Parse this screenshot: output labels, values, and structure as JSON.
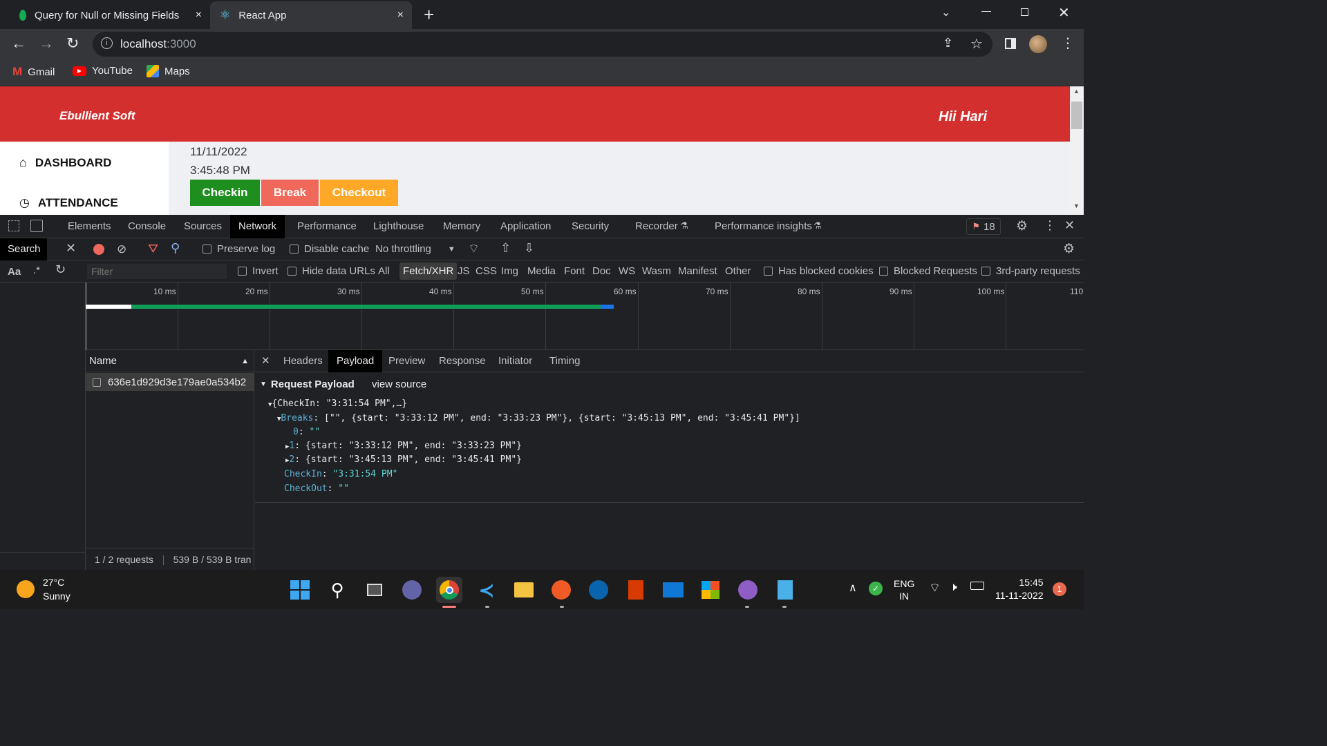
{
  "browser": {
    "tabs": [
      {
        "title": "Query for Null or Missing Fields",
        "close": "×"
      },
      {
        "title": "React App",
        "close": "×"
      }
    ],
    "new_tab": "+",
    "address": {
      "host": "localhost",
      "port": ":3000"
    },
    "bookmarks": [
      {
        "label": "Gmail"
      },
      {
        "label": "YouTube"
      },
      {
        "label": "Maps"
      }
    ]
  },
  "page": {
    "brand": "Ebullient Soft",
    "greeting": "Hii Hari",
    "sidebar": [
      {
        "label": "DASHBOARD"
      },
      {
        "label": "ATTENDANCE"
      }
    ],
    "date": "11/11/2022",
    "time": "3:45:48 PM",
    "buttons": {
      "checkin": "Checkin",
      "break": "Break",
      "checkout": "Checkout"
    },
    "colors": {
      "header": "#d32f2f",
      "checkin": "#1e8e1e",
      "break": "#f0685a",
      "checkout": "#ffa726"
    }
  },
  "devtools": {
    "tabs": [
      "Elements",
      "Console",
      "Sources",
      "Network",
      "Performance",
      "Lighthouse",
      "Memory",
      "Application",
      "Security",
      "Recorder",
      "Performance insights"
    ],
    "active_tab": "Network",
    "issues_count": "18",
    "toolbar": {
      "search": "Search",
      "preserve_log": "Preserve log",
      "disable_cache": "Disable cache",
      "throttling": "No throttling"
    },
    "filter": {
      "placeholder": "Filter",
      "invert": "Invert",
      "hide_data_urls": "Hide data URLs",
      "types": [
        "All",
        "Fetch/XHR",
        "JS",
        "CSS",
        "Img",
        "Media",
        "Font",
        "Doc",
        "WS",
        "Wasm",
        "Manifest",
        "Other"
      ],
      "active_type": "Fetch/XHR",
      "has_blocked_cookies": "Has blocked cookies",
      "blocked_requests": "Blocked Requests",
      "third_party": "3rd-party requests",
      "aa": "Aa",
      "regex": ".*"
    },
    "timeline_ticks": [
      "10 ms",
      "20 ms",
      "30 ms",
      "40 ms",
      "50 ms",
      "60 ms",
      "70 ms",
      "80 ms",
      "90 ms",
      "100 ms",
      "110"
    ],
    "request_list": {
      "header": "Name",
      "rows": [
        "636e1d929d3e179ae0a534b2"
      ],
      "footer_requests": "1 / 2 requests",
      "footer_size": "539 B / 539 B tran"
    },
    "detail_tabs": [
      "Headers",
      "Payload",
      "Preview",
      "Response",
      "Initiator",
      "Timing"
    ],
    "active_detail_tab": "Payload",
    "payload": {
      "section": "Request Payload",
      "view_source": "view source",
      "summary": "{CheckIn: \"3:31:54 PM\",…}",
      "breaks_key": "Breaks",
      "breaks_summary": "[\"\", {start: \"3:33:12 PM\", end: \"3:33:23 PM\"}, {start: \"3:45:13 PM\", end: \"3:45:41 PM\"}]",
      "break_items": [
        {
          "key": "0",
          "value": "\"\""
        },
        {
          "key": "1",
          "value": "{start: \"3:33:12 PM\", end: \"3:33:23 PM\"}"
        },
        {
          "key": "2",
          "value": "{start: \"3:45:13 PM\", end: \"3:45:41 PM\"}"
        }
      ],
      "checkin_key": "CheckIn",
      "checkin_value": "\"3:31:54 PM\"",
      "checkout_key": "CheckOut",
      "checkout_value": "\"\""
    }
  },
  "taskbar": {
    "weather_temp": "27°C",
    "weather_desc": "Sunny",
    "lang": "ENG",
    "region": "IN",
    "time": "15:45",
    "date": "11-11-2022",
    "notifications": "1"
  }
}
